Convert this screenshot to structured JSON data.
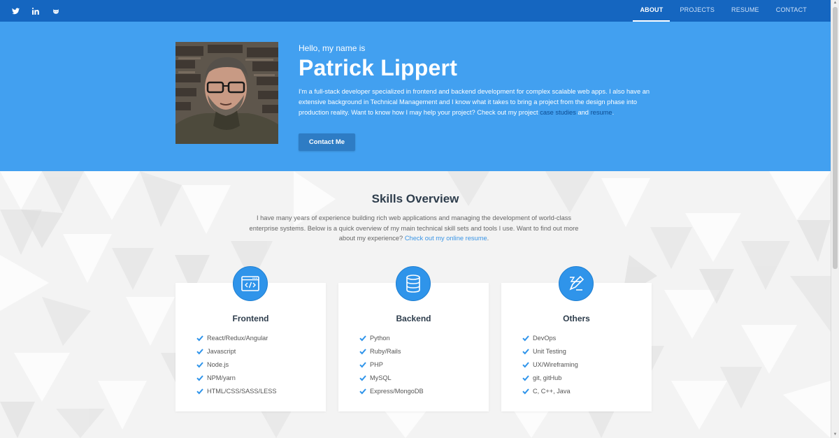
{
  "topnav": {
    "social": [
      {
        "icon": "twitter-icon"
      },
      {
        "icon": "linkedin-icon"
      },
      {
        "icon": "github-icon"
      }
    ],
    "links": [
      {
        "label": "ABOUT",
        "active": true
      },
      {
        "label": "PROJECTS",
        "active": false
      },
      {
        "label": "RESUME",
        "active": false
      },
      {
        "label": "CONTACT",
        "active": false
      }
    ]
  },
  "hero": {
    "greeting": "Hello, my name is",
    "name": "Patrick Lippert",
    "intro_text": "I'm a full-stack developer specialized in frontend and backend development for complex scalable web apps. I also have an extensive background in Technical Management and I know what it takes to bring a project from the design phase into production reality. Want to know how I may help your project? Check out my project",
    "link_case_studies": "case studies",
    "and_text": " and ",
    "link_resume": "resume",
    "end_text": ".",
    "contact_button": "Contact Me"
  },
  "skills": {
    "title": "Skills Overview",
    "text": "I have many years of experience building rich web applications and managing the development of world-class enterprise systems. Below is a quick overview of my main technical skill sets and tools I use. Want to find out more about my experience?",
    "link_text": "Check out my online resume",
    "end_text": ".",
    "cards": [
      {
        "title": "Frontend",
        "icon": "code-window-icon",
        "items": [
          "React/Redux/Angular",
          "Javascript",
          "Node.js",
          "NPM/yarn",
          "HTML/CSS/SASS/LESS"
        ]
      },
      {
        "title": "Backend",
        "icon": "database-icon",
        "items": [
          "Python",
          "Ruby/Rails",
          "PHP",
          "MySQL",
          "Express/MongoDB"
        ]
      },
      {
        "title": "Others",
        "icon": "pen-ruler-icon",
        "items": [
          "DevOps",
          "Unit Testing",
          "UX/Wireframing",
          "git, gitHub",
          "C, C++, Java"
        ]
      }
    ]
  },
  "colors": {
    "nav_bg": "#1566c0",
    "hero_bg": "#42a0f0",
    "accent": "#2f94ea",
    "button_bg": "#2e7cc4",
    "heading": "#2e3d4c"
  }
}
